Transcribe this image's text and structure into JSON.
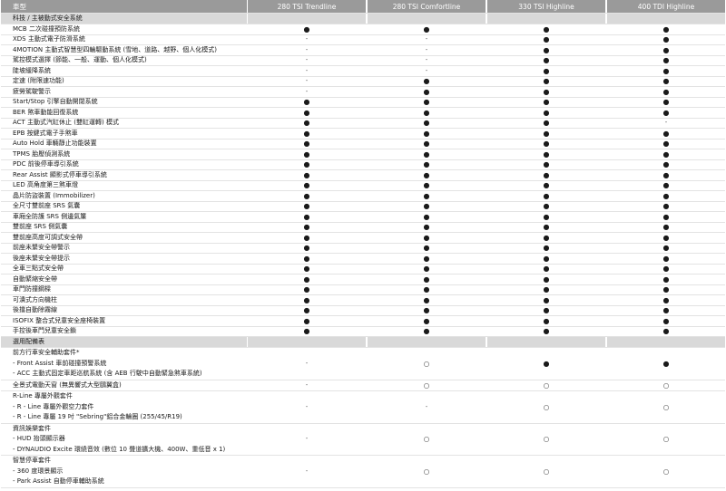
{
  "header": {
    "label": "車型",
    "models": [
      "280 TSI Trendline",
      "280 TSI Comfortline",
      "330 TSI Highline",
      "400 TDI Highline"
    ]
  },
  "symbols": {
    "standard": "●",
    "optional": "○",
    "none": "-"
  },
  "sections": [
    {
      "title": "科技 / 主被動式安全系統",
      "rows": [
        {
          "label": "MCB 二次碰撞預防系統",
          "values": [
            "●",
            "●",
            "●",
            "●"
          ]
        },
        {
          "label": "XDS 主動式電子防滑系統",
          "values": [
            "-",
            "-",
            "●",
            "●"
          ]
        },
        {
          "label": "4MOTION 主動式智慧型四輪驅動系統 (雪地、道路、越野、個人化模式)",
          "values": [
            "-",
            "-",
            "●",
            "●"
          ]
        },
        {
          "label": "駕控模式選擇 (節能、一般、運動、個人化模式)",
          "values": [
            "-",
            "-",
            "●",
            "●"
          ]
        },
        {
          "label": "陡坡緩降系統",
          "values": [
            "-",
            "-",
            "●",
            "●"
          ]
        },
        {
          "label": "定速 (附限速功能)",
          "values": [
            "-",
            "●",
            "●",
            "●"
          ]
        },
        {
          "label": "疲勞駕駛警示",
          "values": [
            "-",
            "●",
            "●",
            "●"
          ]
        },
        {
          "label": "Start/Stop 引擎自動開閉系統",
          "values": [
            "●",
            "●",
            "●",
            "●"
          ]
        },
        {
          "label": "BER 煞車動能回復系統",
          "values": [
            "●",
            "●",
            "●",
            "●"
          ]
        },
        {
          "label": "ACT 主動式汽缸休止 (雙缸運轉) 模式",
          "values": [
            "●",
            "●",
            "●",
            "-"
          ]
        },
        {
          "label": "EPB 按鍵式電子手煞車",
          "values": [
            "●",
            "●",
            "●",
            "●"
          ]
        },
        {
          "label": "Auto Hold 車輛靜止功能裝置",
          "values": [
            "●",
            "●",
            "●",
            "●"
          ]
        },
        {
          "label": "TPMS 胎壓偵測系統",
          "values": [
            "●",
            "●",
            "●",
            "●"
          ]
        },
        {
          "label": "PDC 前後停車導引系統",
          "values": [
            "●",
            "●",
            "●",
            "●"
          ]
        },
        {
          "label": "Rear Assist 顯影式停車導引系統",
          "values": [
            "●",
            "●",
            "●",
            "●"
          ]
        },
        {
          "label": "LED 高角度第三煞車燈",
          "values": [
            "●",
            "●",
            "●",
            "●"
          ]
        },
        {
          "label": "晶片防盜裝置 (Immobilizer)",
          "values": [
            "●",
            "●",
            "●",
            "●"
          ]
        },
        {
          "label": "全尺寸雙前座 SRS 氣囊",
          "values": [
            "●",
            "●",
            "●",
            "●"
          ]
        },
        {
          "label": "車廂全防護 SRS 側邊氣簾",
          "values": [
            "●",
            "●",
            "●",
            "●"
          ]
        },
        {
          "label": "雙前座 SRS 側氣囊",
          "values": [
            "●",
            "●",
            "●",
            "●"
          ]
        },
        {
          "label": "雙前座高度可調式安全帶",
          "values": [
            "●",
            "●",
            "●",
            "●"
          ]
        },
        {
          "label": "前座未繫安全帶警示",
          "values": [
            "●",
            "●",
            "●",
            "●"
          ]
        },
        {
          "label": "後座未繫安全帶提示",
          "values": [
            "●",
            "●",
            "●",
            "●"
          ]
        },
        {
          "label": "全車三點式安全帶",
          "values": [
            "●",
            "●",
            "●",
            "●"
          ]
        },
        {
          "label": "自動緊縮安全帶",
          "values": [
            "●",
            "●",
            "●",
            "●"
          ]
        },
        {
          "label": "車門防撞鋼樑",
          "values": [
            "●",
            "●",
            "●",
            "●"
          ]
        },
        {
          "label": "可潰式方向機柱",
          "values": [
            "●",
            "●",
            "●",
            "●"
          ]
        },
        {
          "label": "後擋自動除霧線",
          "values": [
            "●",
            "●",
            "●",
            "●"
          ]
        },
        {
          "label": "ISOFIX 整合式兒童安全座椅裝置",
          "values": [
            "●",
            "●",
            "●",
            "●"
          ]
        },
        {
          "label": "手控後車門兒童安全鎖",
          "values": [
            "●",
            "●",
            "●",
            "●"
          ]
        }
      ]
    },
    {
      "title": "選用配備表",
      "groups": [
        {
          "lines": [
            "前方行車安全輔助套件*",
            "- Front Assist 車前碰撞預警系統",
            "- ACC 主動式固定車距巡航系統 (含 AEB 行駛中自動緊急煞車系統)"
          ],
          "values": [
            "-",
            "○",
            "●",
            "●"
          ]
        },
        {
          "lines": [
            "全景式電動天窗 (無異響式大型鷗翼盒)"
          ],
          "values": [
            "-",
            "○",
            "○",
            "○"
          ]
        },
        {
          "lines": [
            "R-Line 專屬外觀套件",
            "- R - Line 專屬外觀空力套件",
            "- R - Line 專屬 19 吋 \"Sebring\"鋁合金輪圈 (255/45/R19)"
          ],
          "values": [
            "-",
            "-",
            "○",
            "○"
          ]
        },
        {
          "lines": [
            "資訊娛樂套件",
            "- HUD 抬頭顯示器",
            "- DYNAUDIO Excite 環繞音效 (數位 10 聲道擴大機、400W、重低音 x 1)"
          ],
          "values": [
            "-",
            "○",
            "○",
            "○"
          ]
        },
        {
          "lines": [
            "智慧停車套件",
            "- 360 度環景顯示",
            "- Park Assist 自動停車輔助系統"
          ],
          "values": [
            "-",
            "○",
            "○",
            "○"
          ]
        }
      ]
    }
  ]
}
